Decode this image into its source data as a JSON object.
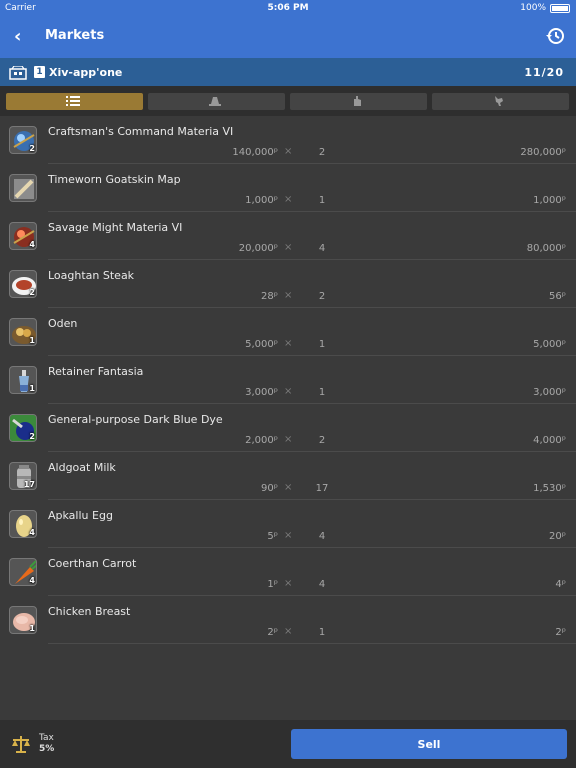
{
  "status_bar": {
    "carrier": "Carrier",
    "time": "5:06 PM",
    "battery": "100%"
  },
  "nav": {
    "back_icon": "chevron-left-icon",
    "title": "Markets",
    "history_icon": "history-icon"
  },
  "retainer": {
    "icon": "retainer-icon",
    "number": "1",
    "name": "Xiv-app'one",
    "slots": "11/20"
  },
  "tabs": [
    {
      "icon": "list-icon",
      "active": true
    },
    {
      "icon": "hat-icon",
      "active": false
    },
    {
      "icon": "glove-icon",
      "active": false
    },
    {
      "icon": "chocobo-icon",
      "active": false
    }
  ],
  "times_symbol": "×",
  "items": [
    {
      "name": "Craftsman's Command Materia VI",
      "unit_price": "140,000ᵖ",
      "count": "2",
      "total": "280,000ᵖ",
      "stack": "2",
      "icon": "materia-blue-icon"
    },
    {
      "name": "Timeworn Goatskin Map",
      "unit_price": "1,000ᵖ",
      "count": "1",
      "total": "1,000ᵖ",
      "stack": "",
      "icon": "map-icon"
    },
    {
      "name": "Savage Might Materia VI",
      "unit_price": "20,000ᵖ",
      "count": "4",
      "total": "80,000ᵖ",
      "stack": "4",
      "icon": "materia-red-icon"
    },
    {
      "name": "Loaghtan Steak",
      "unit_price": "28ᵖ",
      "count": "2",
      "total": "56ᵖ",
      "stack": "2",
      "icon": "steak-icon"
    },
    {
      "name": "Oden",
      "unit_price": "5,000ᵖ",
      "count": "1",
      "total": "5,000ᵖ",
      "stack": "1",
      "icon": "oden-icon"
    },
    {
      "name": "Retainer Fantasia",
      "unit_price": "3,000ᵖ",
      "count": "1",
      "total": "3,000ᵖ",
      "stack": "1",
      "icon": "potion-icon"
    },
    {
      "name": "General-purpose Dark Blue Dye",
      "unit_price": "2,000ᵖ",
      "count": "2",
      "total": "4,000ᵖ",
      "stack": "2",
      "icon": "dye-icon"
    },
    {
      "name": "Aldgoat Milk",
      "unit_price": "90ᵖ",
      "count": "17",
      "total": "1,530ᵖ",
      "stack": "17",
      "icon": "milk-icon"
    },
    {
      "name": "Apkallu Egg",
      "unit_price": "5ᵖ",
      "count": "4",
      "total": "20ᵖ",
      "stack": "4",
      "icon": "egg-icon"
    },
    {
      "name": "Coerthan Carrot",
      "unit_price": "1ᵖ",
      "count": "4",
      "total": "4ᵖ",
      "stack": "4",
      "icon": "carrot-icon"
    },
    {
      "name": "Chicken Breast",
      "unit_price": "2ᵖ",
      "count": "1",
      "total": "2ᵖ",
      "stack": "1",
      "icon": "chicken-icon"
    }
  ],
  "footer": {
    "tax_icon": "scales-icon",
    "tax_label": "Tax",
    "tax_value": "5%",
    "sell_label": "Sell"
  },
  "colors": {
    "nav_blue": "#3d73d0",
    "retainer_blue": "#2c5f96",
    "tab_active": "#9a7a34",
    "background": "#3a3a3a"
  }
}
